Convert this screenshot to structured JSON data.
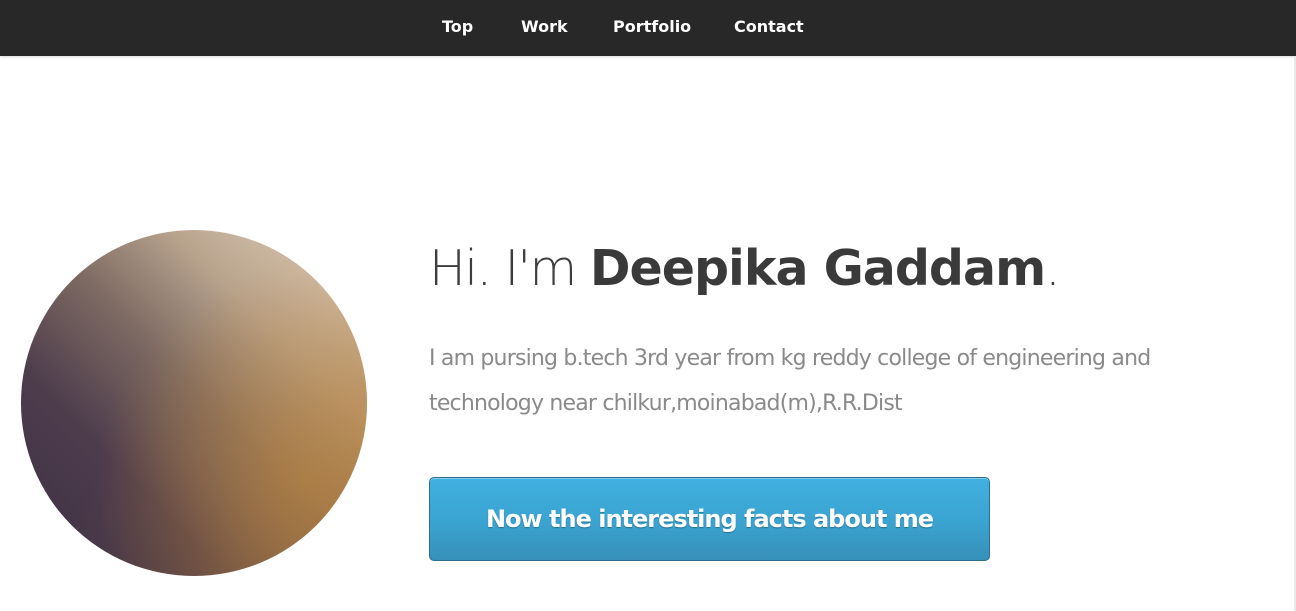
{
  "nav": {
    "items": [
      {
        "label": "Top"
      },
      {
        "label": "Work"
      },
      {
        "label": "Portfolio"
      },
      {
        "label": "Contact"
      }
    ]
  },
  "hero": {
    "greeting": "Hi. I'm",
    "name": "Deepika Gaddam",
    "period": ".",
    "intro": "I am pursing b.tech 3rd year from kg reddy college of engineering and technology near chilkur,moinabad(m),R.R.Dist",
    "button_label": "Now the interesting facts about me"
  },
  "colors": {
    "navbar_background": "#282828",
    "button_blue": "#3aa3d0",
    "heading_text": "#3d3d3d",
    "intro_text": "#8a8a8a"
  }
}
